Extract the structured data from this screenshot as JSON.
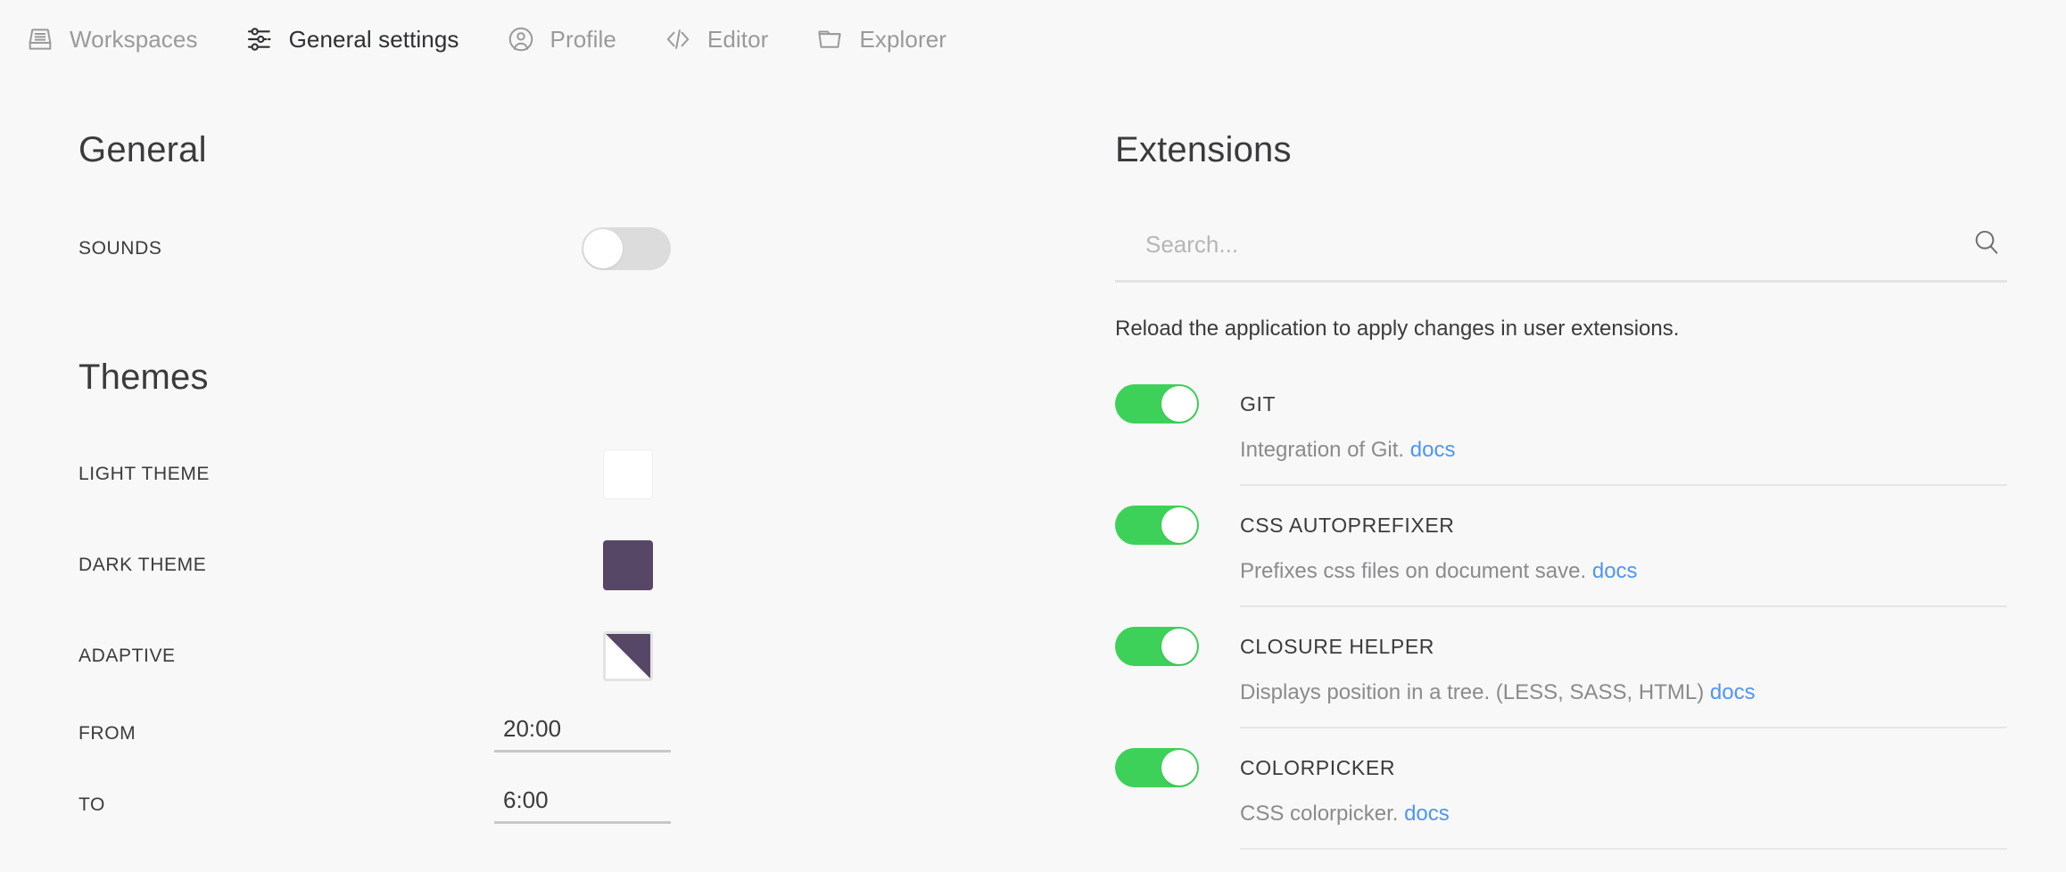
{
  "navbar": {
    "items": [
      {
        "label": "Workspaces",
        "icon": "workspaces-icon",
        "active": false
      },
      {
        "label": "General settings",
        "icon": "sliders-icon",
        "active": true
      },
      {
        "label": "Profile",
        "icon": "profile-icon",
        "active": false
      },
      {
        "label": "Editor",
        "icon": "code-icon",
        "active": false
      },
      {
        "label": "Explorer",
        "icon": "folder-icon",
        "active": false
      }
    ]
  },
  "general": {
    "title": "General",
    "sounds": {
      "label": "SOUNDS",
      "enabled": false
    }
  },
  "themes": {
    "title": "Themes",
    "rows": [
      {
        "label": "LIGHT THEME",
        "swatch": "light",
        "color": "#ffffff"
      },
      {
        "label": "DARK THEME",
        "swatch": "dark",
        "color": "#574767"
      },
      {
        "label": "ADAPTIVE",
        "swatch": "adaptive",
        "color": "#574767"
      }
    ],
    "from": {
      "label": "FROM",
      "value": "20:00",
      "placeholder": "20:00"
    },
    "to": {
      "label": "TO",
      "value": "6:00",
      "placeholder": "6:00"
    }
  },
  "extensions": {
    "title": "Extensions",
    "search": {
      "value": "",
      "placeholder": "Search...",
      "icon": "search-icon"
    },
    "reload_note": "Reload the application to apply changes in user extensions.",
    "items": [
      {
        "name": "GIT",
        "enabled": true,
        "description": "Integration of Git.",
        "docs_label": "docs"
      },
      {
        "name": "CSS AUTOPREFIXER",
        "enabled": true,
        "description": "Prefixes css files on document save.",
        "docs_label": "docs"
      },
      {
        "name": "CLOSURE HELPER",
        "enabled": true,
        "description": "Displays position in a tree. (LESS, SASS, HTML)",
        "docs_label": "docs"
      },
      {
        "name": "COLORPICKER",
        "enabled": true,
        "description": "CSS colorpicker.",
        "docs_label": "docs"
      }
    ]
  },
  "colors": {
    "background": "#f8f8f8",
    "toggle_on": "#3ed159",
    "toggle_off": "#dcdcdc",
    "accent_dark_theme": "#574767",
    "link": "#4e96f0",
    "text_primary": "#3b3b3d",
    "text_muted": "#8b8b8d",
    "nav_inactive": "#9a9a9c"
  }
}
